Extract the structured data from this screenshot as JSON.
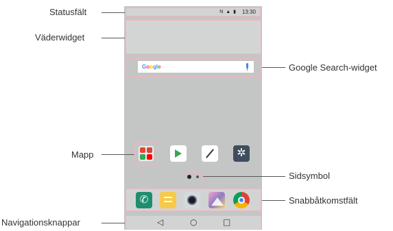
{
  "status_bar": {
    "time": "13:30",
    "icons": "N ▲ ▮"
  },
  "search_widget": {
    "logo": "Google"
  },
  "apps": {
    "settings_glyph": "✲",
    "phone_glyph": "✆"
  },
  "nav_buttons": {
    "back": "◁",
    "home": "○",
    "recents": "□"
  },
  "labels": {
    "statusbar": "Statusfält",
    "weather": "Väderwidget",
    "google_search": "Google Search-widget",
    "folder": "Mapp",
    "page_indicator": "Sidsymbol",
    "quick_access": "Snabbåtkomstfält",
    "nav_keys": "Navigationsknappar"
  },
  "colors": {
    "highlight": "#f3b4c0",
    "screen": "#c3c6c5"
  }
}
